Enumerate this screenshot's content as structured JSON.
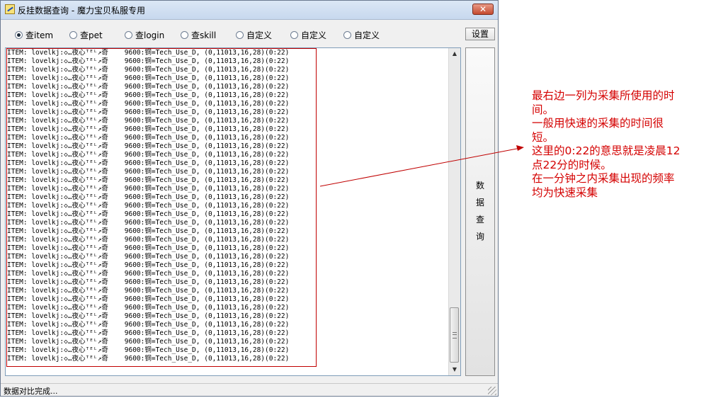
{
  "window": {
    "title": "反挂数据查询 - 魔力宝贝私服专用",
    "close_label": "✕"
  },
  "radios": [
    {
      "label": "查item",
      "selected": true
    },
    {
      "label": "查pet",
      "selected": false
    },
    {
      "label": "查login",
      "selected": false
    },
    {
      "label": "查skill",
      "selected": false
    },
    {
      "label": "自定义",
      "selected": false
    },
    {
      "label": "自定义",
      "selected": false
    },
    {
      "label": "自定义",
      "selected": false
    }
  ],
  "buttons": {
    "settings": "设置",
    "query": [
      "数",
      "据",
      "查",
      "询"
    ]
  },
  "log": {
    "line": "ITEM: lovelkj:◇…夜心ᵀᴱᴸ↗奇    9600:铜=Tech_Use_D, (0,11013,16,28)(0:22)",
    "count": 37
  },
  "status": "数据对比完成...",
  "annotation": {
    "color": "#d40000",
    "lines": [
      "最右边一列为采集所使用的时",
      "间。",
      "一般用快速的采集的时间很",
      "短。",
      "这里的0:22的意思就是凌晨12",
      "点22分的时候。",
      "在一分钟之内采集出现的频率",
      "均为快速采集"
    ]
  },
  "icons": {
    "app": "app-icon",
    "close": "close-icon",
    "scroll_up": "scroll-up-arrow-icon",
    "scroll_down": "scroll-down-arrow-icon"
  }
}
